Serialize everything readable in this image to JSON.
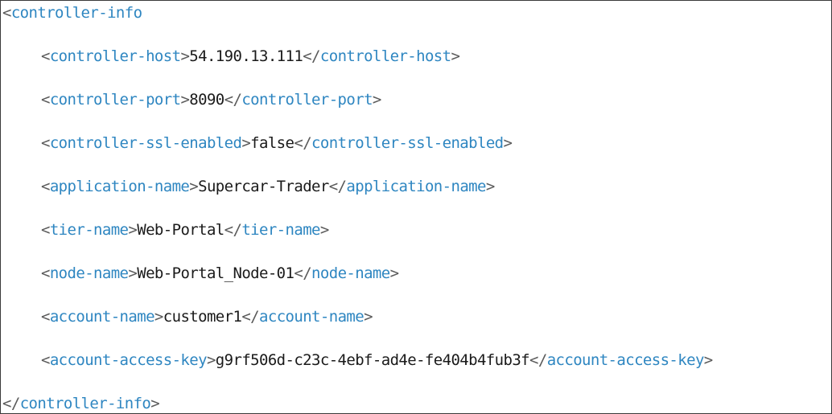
{
  "root_tag": "controller-info",
  "elements": [
    {
      "tag": "controller-host",
      "value": "54.190.13.111"
    },
    {
      "tag": "controller-port",
      "value": "8090"
    },
    {
      "tag": "controller-ssl-enabled",
      "value": "false"
    },
    {
      "tag": "application-name",
      "value": "Supercar-Trader"
    },
    {
      "tag": "tier-name",
      "value": "Web-Portal"
    },
    {
      "tag": "node-name",
      "value": "Web-Portal_Node-01"
    },
    {
      "tag": "account-name",
      "value": "customer1"
    },
    {
      "tag": "account-access-key",
      "value": "g9rf506d-c23c-4ebf-ad4e-fe404b4fub3f"
    }
  ],
  "colors": {
    "tag": "#2e86c1",
    "bracket": "#5a5a5a",
    "value": "#1a1a1a",
    "border": "#3a3a3a"
  }
}
